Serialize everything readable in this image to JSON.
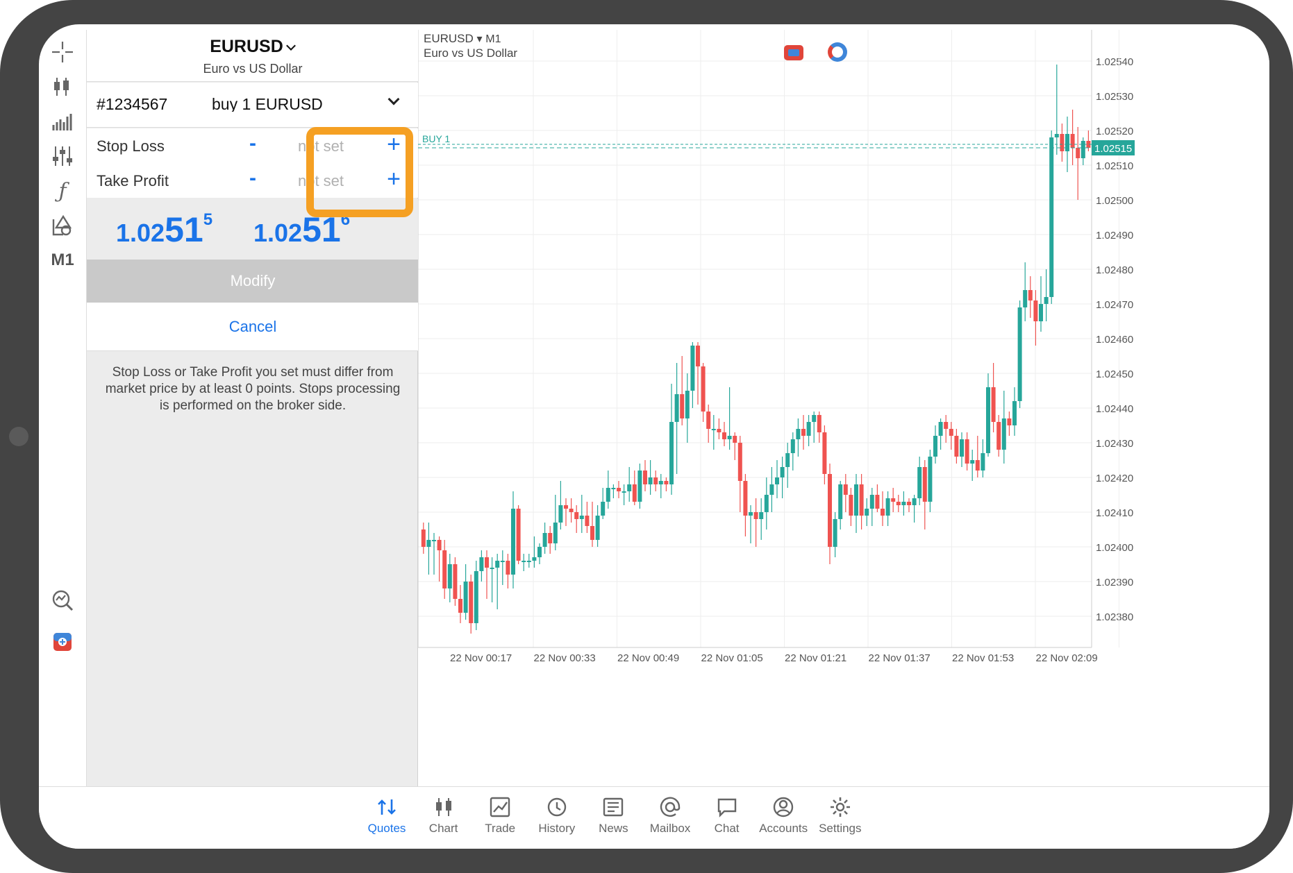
{
  "order_panel": {
    "symbol": "EURUSD",
    "symbol_desc": "Euro vs US Dollar",
    "ticket": "#1234567",
    "order_type": "buy 1 EURUSD",
    "stop_loss_label": "Stop Loss",
    "take_profit_label": "Take Profit",
    "minus": "-",
    "plus": "+",
    "stop_loss_value": "not set",
    "take_profit_value": "not set",
    "bid": {
      "a": "1.02",
      "b": "51",
      "c": "5"
    },
    "ask": {
      "a": "1.02",
      "b": "51",
      "c": "6"
    },
    "modify_label": "Modify",
    "cancel_label": "Cancel",
    "note": "Stop Loss or Take Profit you set must differ from market price by at least 0 points. Stops processing is performed on the broker side."
  },
  "toolbar": {
    "icons": [
      "crosshair-icon",
      "candlestick-icon",
      "indicators-icon",
      "settings-sliders-icon",
      "function-icon",
      "objects-icon",
      "timeframe-icon",
      "analytics-icon",
      "trade-signal-icon"
    ],
    "timeframe": "M1"
  },
  "chart": {
    "symbol": "EURUSD",
    "timeframe_arrow": "▾",
    "timeframe": "M1",
    "symbol_desc": "Euro vs US Dollar",
    "position_label": "BUY 1",
    "current_price": "1.02515",
    "colors": {
      "up": "#26a69a",
      "down": "#ef5350",
      "grid": "#eeeeee",
      "price_line": "#26a69a"
    }
  },
  "chart_data": {
    "type": "candlestick",
    "y_ticks": [
      "1.02540",
      "1.02530",
      "1.02520",
      "1.02510",
      "1.02500",
      "1.02490",
      "1.02480",
      "1.02470",
      "1.02460",
      "1.02450",
      "1.02440",
      "1.02430",
      "1.02420",
      "1.02410",
      "1.02400",
      "1.02390",
      "1.02380"
    ],
    "x_ticks": [
      "22 Nov 00:17",
      "22 Nov 00:33",
      "22 Nov 00:49",
      "22 Nov 01:05",
      "22 Nov 01:21",
      "22 Nov 01:37",
      "22 Nov 01:53",
      "22 Nov 02:09"
    ],
    "ylim": [
      1.02371,
      1.02549
    ],
    "current_price": 1.02515,
    "position_open_price": 1.02516,
    "candles_ohlc": [
      [
        1.02405,
        1.02407,
        1.02398,
        1.024
      ],
      [
        1.024,
        1.02407,
        1.02392,
        1.02402
      ],
      [
        1.02402,
        1.02404,
        1.02392,
        1.02402
      ],
      [
        1.02402,
        1.02403,
        1.0239,
        1.02399
      ],
      [
        1.02399,
        1.02402,
        1.02385,
        1.02388
      ],
      [
        1.02388,
        1.02398,
        1.02384,
        1.02395
      ],
      [
        1.02395,
        1.02397,
        1.02383,
        1.02385
      ],
      [
        1.02385,
        1.02389,
        1.02378,
        1.02381
      ],
      [
        1.02381,
        1.02395,
        1.02379,
        1.0239
      ],
      [
        1.0239,
        1.02392,
        1.02375,
        1.02378
      ],
      [
        1.02378,
        1.02396,
        1.02376,
        1.02393
      ],
      [
        1.02393,
        1.02399,
        1.0239,
        1.02397
      ],
      [
        1.02397,
        1.02399,
        1.02385,
        1.02394
      ],
      [
        1.02394,
        1.02397,
        1.02384,
        1.02394
      ],
      [
        1.02394,
        1.02398,
        1.02382,
        1.02396
      ],
      [
        1.02396,
        1.02399,
        1.02389,
        1.02396
      ],
      [
        1.02396,
        1.02398,
        1.02388,
        1.02392
      ],
      [
        1.02392,
        1.02416,
        1.02388,
        1.02411
      ],
      [
        1.02411,
        1.02412,
        1.02395,
        1.02396
      ],
      [
        1.02396,
        1.02398,
        1.02393,
        1.02396
      ],
      [
        1.02396,
        1.02398,
        1.02394,
        1.02396
      ],
      [
        1.02396,
        1.02403,
        1.02394,
        1.02397
      ],
      [
        1.02397,
        1.02401,
        1.02395,
        1.024
      ],
      [
        1.024,
        1.02407,
        1.02398,
        1.02404
      ],
      [
        1.02404,
        1.02406,
        1.02398,
        1.02401
      ],
      [
        1.02401,
        1.02415,
        1.02399,
        1.02407
      ],
      [
        1.02407,
        1.02419,
        1.02405,
        1.02412
      ],
      [
        1.02412,
        1.02414,
        1.02406,
        1.02411
      ],
      [
        1.02411,
        1.02414,
        1.02407,
        1.0241
      ],
      [
        1.0241,
        1.02412,
        1.02404,
        1.02408
      ],
      [
        1.02408,
        1.02415,
        1.02404,
        1.02409
      ],
      [
        1.02409,
        1.02413,
        1.02404,
        1.02406
      ],
      [
        1.02406,
        1.02413,
        1.024,
        1.02402
      ],
      [
        1.02402,
        1.02412,
        1.024,
        1.02409
      ],
      [
        1.02409,
        1.02417,
        1.02408,
        1.02413
      ],
      [
        1.02413,
        1.02422,
        1.02411,
        1.02417
      ],
      [
        1.02417,
        1.02418,
        1.02414,
        1.02417
      ],
      [
        1.02417,
        1.02419,
        1.02414,
        1.02416
      ],
      [
        1.02416,
        1.02418,
        1.02412,
        1.02416
      ],
      [
        1.02416,
        1.02423,
        1.02413,
        1.02418
      ],
      [
        1.02418,
        1.02422,
        1.02412,
        1.02413
      ],
      [
        1.02413,
        1.02424,
        1.02411,
        1.02422
      ],
      [
        1.02422,
        1.02425,
        1.02416,
        1.02418
      ],
      [
        1.02418,
        1.02425,
        1.02415,
        1.0242
      ],
      [
        1.0242,
        1.02422,
        1.02416,
        1.02418
      ],
      [
        1.02418,
        1.02421,
        1.02414,
        1.02419
      ],
      [
        1.02419,
        1.0242,
        1.02416,
        1.02418
      ],
      [
        1.02418,
        1.02447,
        1.02415,
        1.02436
      ],
      [
        1.02436,
        1.02453,
        1.02421,
        1.02444
      ],
      [
        1.02444,
        1.02455,
        1.02435,
        1.02437
      ],
      [
        1.02437,
        1.0245,
        1.0243,
        1.02445
      ],
      [
        1.02445,
        1.02459,
        1.0244,
        1.02458
      ],
      [
        1.02458,
        1.02459,
        1.02441,
        1.02452
      ],
      [
        1.02452,
        1.02453,
        1.02436,
        1.02439
      ],
      [
        1.02439,
        1.02441,
        1.0243,
        1.02434
      ],
      [
        1.02434,
        1.02438,
        1.02428,
        1.02434
      ],
      [
        1.02434,
        1.02437,
        1.02431,
        1.02433
      ],
      [
        1.02433,
        1.02436,
        1.02429,
        1.02431
      ],
      [
        1.02431,
        1.02446,
        1.02428,
        1.02432
      ],
      [
        1.02432,
        1.02433,
        1.02425,
        1.0243
      ],
      [
        1.0243,
        1.02432,
        1.0241,
        1.02419
      ],
      [
        1.02419,
        1.02421,
        1.02403,
        1.02409
      ],
      [
        1.02409,
        1.02412,
        1.02401,
        1.0241
      ],
      [
        1.0241,
        1.02414,
        1.024,
        1.02408
      ],
      [
        1.02408,
        1.02414,
        1.02402,
        1.0241
      ],
      [
        1.0241,
        1.0242,
        1.02405,
        1.02415
      ],
      [
        1.02415,
        1.02423,
        1.0241,
        1.02418
      ],
      [
        1.02418,
        1.02425,
        1.02414,
        1.0242
      ],
      [
        1.0242,
        1.02426,
        1.02414,
        1.02423
      ],
      [
        1.02423,
        1.0243,
        1.02417,
        1.02427
      ],
      [
        1.02427,
        1.02433,
        1.02422,
        1.02431
      ],
      [
        1.02431,
        1.02437,
        1.02426,
        1.02434
      ],
      [
        1.02434,
        1.02438,
        1.02428,
        1.02432
      ],
      [
        1.02432,
        1.02438,
        1.02429,
        1.02436
      ],
      [
        1.02436,
        1.02439,
        1.0243,
        1.02438
      ],
      [
        1.02438,
        1.02439,
        1.0243,
        1.02433
      ],
      [
        1.02433,
        1.02435,
        1.02418,
        1.02421
      ],
      [
        1.02421,
        1.02424,
        1.02395,
        1.024
      ],
      [
        1.024,
        1.0241,
        1.02397,
        1.02408
      ],
      [
        1.02408,
        1.02419,
        1.02405,
        1.02418
      ],
      [
        1.02418,
        1.02421,
        1.0241,
        1.02415
      ],
      [
        1.02415,
        1.02417,
        1.02406,
        1.02409
      ],
      [
        1.02409,
        1.02421,
        1.02404,
        1.02418
      ],
      [
        1.02418,
        1.02421,
        1.02405,
        1.02409
      ],
      [
        1.02409,
        1.02414,
        1.02406,
        1.02411
      ],
      [
        1.02411,
        1.02417,
        1.02406,
        1.02415
      ],
      [
        1.02415,
        1.02418,
        1.0241,
        1.02411
      ],
      [
        1.02411,
        1.02416,
        1.02406,
        1.02409
      ],
      [
        1.02409,
        1.02416,
        1.02406,
        1.02414
      ],
      [
        1.02414,
        1.02417,
        1.0241,
        1.02413
      ],
      [
        1.02413,
        1.02415,
        1.0241,
        1.02412
      ],
      [
        1.02412,
        1.02416,
        1.02409,
        1.02413
      ],
      [
        1.02413,
        1.02414,
        1.0241,
        1.02412
      ],
      [
        1.02412,
        1.02415,
        1.02407,
        1.02414
      ],
      [
        1.02414,
        1.02426,
        1.02412,
        1.02423
      ],
      [
        1.02423,
        1.02425,
        1.02405,
        1.02413
      ],
      [
        1.02413,
        1.02428,
        1.0241,
        1.02426
      ],
      [
        1.02426,
        1.02435,
        1.02424,
        1.02432
      ],
      [
        1.02432,
        1.02437,
        1.02428,
        1.02436
      ],
      [
        1.02436,
        1.02438,
        1.0243,
        1.02434
      ],
      [
        1.02434,
        1.02436,
        1.02428,
        1.02432
      ],
      [
        1.02432,
        1.02434,
        1.02424,
        1.02426
      ],
      [
        1.02426,
        1.02433,
        1.02423,
        1.02431
      ],
      [
        1.02431,
        1.02433,
        1.02422,
        1.02424
      ],
      [
        1.02424,
        1.02428,
        1.02419,
        1.02425
      ],
      [
        1.02425,
        1.02432,
        1.0242,
        1.02422
      ],
      [
        1.02422,
        1.02431,
        1.0242,
        1.02427
      ],
      [
        1.02427,
        1.0245,
        1.02426,
        1.02446
      ],
      [
        1.02446,
        1.02453,
        1.02433,
        1.02436
      ],
      [
        1.02436,
        1.02438,
        1.02426,
        1.02428
      ],
      [
        1.02428,
        1.02445,
        1.02424,
        1.02437
      ],
      [
        1.02437,
        1.02439,
        1.02432,
        1.02435
      ],
      [
        1.02435,
        1.02446,
        1.02432,
        1.02442
      ],
      [
        1.02442,
        1.02471,
        1.0244,
        1.02469
      ],
      [
        1.02469,
        1.02482,
        1.02465,
        1.02474
      ],
      [
        1.02474,
        1.02478,
        1.02466,
        1.02471
      ],
      [
        1.02471,
        1.02474,
        1.02458,
        1.02465
      ],
      [
        1.02465,
        1.02478,
        1.02462,
        1.0247
      ],
      [
        1.0247,
        1.0248,
        1.02465,
        1.02472
      ],
      [
        1.02472,
        1.0252,
        1.0247,
        1.02518
      ],
      [
        1.02518,
        1.02539,
        1.02513,
        1.02519
      ],
      [
        1.02519,
        1.02522,
        1.02511,
        1.02514
      ],
      [
        1.02514,
        1.02524,
        1.02508,
        1.02519
      ],
      [
        1.02519,
        1.02526,
        1.0251,
        1.02515
      ],
      [
        1.02515,
        1.02521,
        1.025,
        1.02512
      ],
      [
        1.02512,
        1.02518,
        1.0251,
        1.02517
      ],
      [
        1.02517,
        1.0252,
        1.02514,
        1.02515
      ]
    ]
  },
  "bottom_nav": [
    {
      "label": "Quotes",
      "icon": "quotes-icon",
      "active": true
    },
    {
      "label": "Chart",
      "icon": "chart-icon",
      "active": false
    },
    {
      "label": "Trade",
      "icon": "trade-icon",
      "active": false
    },
    {
      "label": "History",
      "icon": "history-icon",
      "active": false
    },
    {
      "label": "News",
      "icon": "news-icon",
      "active": false
    },
    {
      "label": "Mailbox",
      "icon": "mailbox-icon",
      "active": false
    },
    {
      "label": "Chat",
      "icon": "chat-icon",
      "active": false
    },
    {
      "label": "Accounts",
      "icon": "accounts-icon",
      "active": false
    },
    {
      "label": "Settings",
      "icon": "settings-icon",
      "active": false
    }
  ]
}
